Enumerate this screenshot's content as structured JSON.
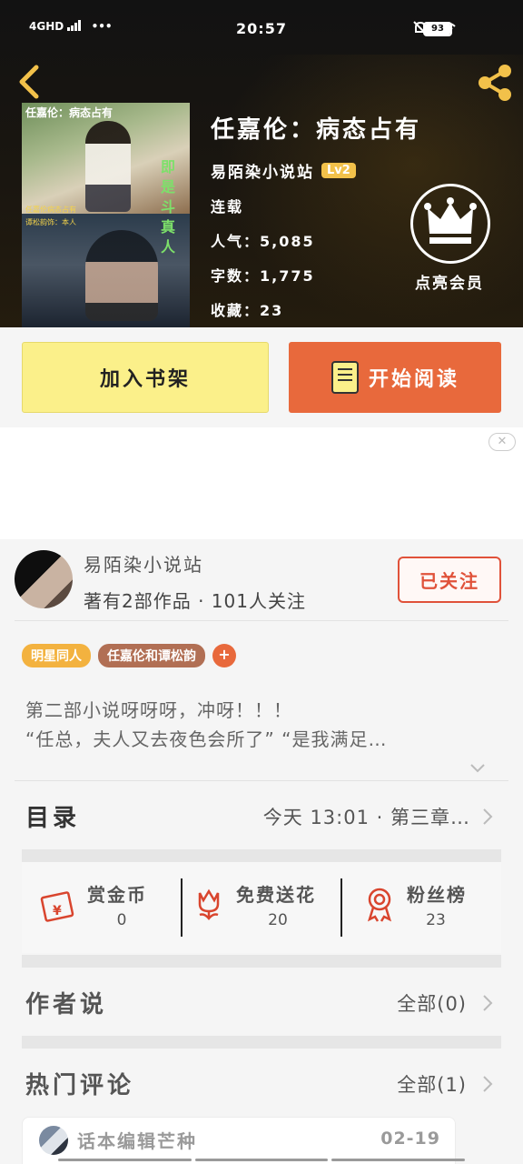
{
  "status_bar": {
    "network": "4GHD",
    "dots": "•••",
    "time": "20:57",
    "battery": "93"
  },
  "book": {
    "cover_title": "任嘉伦：病态占有",
    "cover_vertical_text": "即是斗真人",
    "cover_sub1": "任嘉伦病态占有",
    "cover_sub2": "谭松韵饰：本人",
    "title": "任嘉伦：病态占有",
    "author": "易陌染小说站",
    "level": "Lv2",
    "status": "连载",
    "popularity_label": "人气：",
    "popularity": "5,085",
    "word_count_label": "字数：",
    "word_count": "1,775",
    "favorites_label": "收藏：",
    "favorites": "23"
  },
  "vip": {
    "label": "点亮会员"
  },
  "actions": {
    "add_shelf": "加入书架",
    "start_reading": "开始阅读"
  },
  "author_panel": {
    "name": "易陌染小说站",
    "stats": "著有2部作品 · 101人关注",
    "follow_label": "已关注"
  },
  "tags": [
    "明星同人",
    "任嘉伦和谭松韵"
  ],
  "tag_add": "+",
  "synopsis": {
    "line1": "第二部小说呀呀呀，冲呀！！！",
    "line2": "“任总，夫人又去夜色会所了” “是我满足…"
  },
  "toc": {
    "label": "目录",
    "info": "今天 13:01 · 第三章…"
  },
  "rewards": [
    {
      "label": "赏金币",
      "value": "0"
    },
    {
      "label": "免费送花",
      "value": "20"
    },
    {
      "label": "粉丝榜",
      "value": "23"
    }
  ],
  "author_says": {
    "label": "作者说",
    "all": "全部(0)"
  },
  "hot_comments": {
    "label": "热门评论",
    "all": "全部(1)",
    "first_user": "话本编辑芒种",
    "first_date": "02-19"
  },
  "colors": {
    "accent_orange": "#e8693c",
    "shelf_yellow": "#fbf08a",
    "level_gold": "#f2c14a",
    "follow_red": "#e0523a"
  }
}
